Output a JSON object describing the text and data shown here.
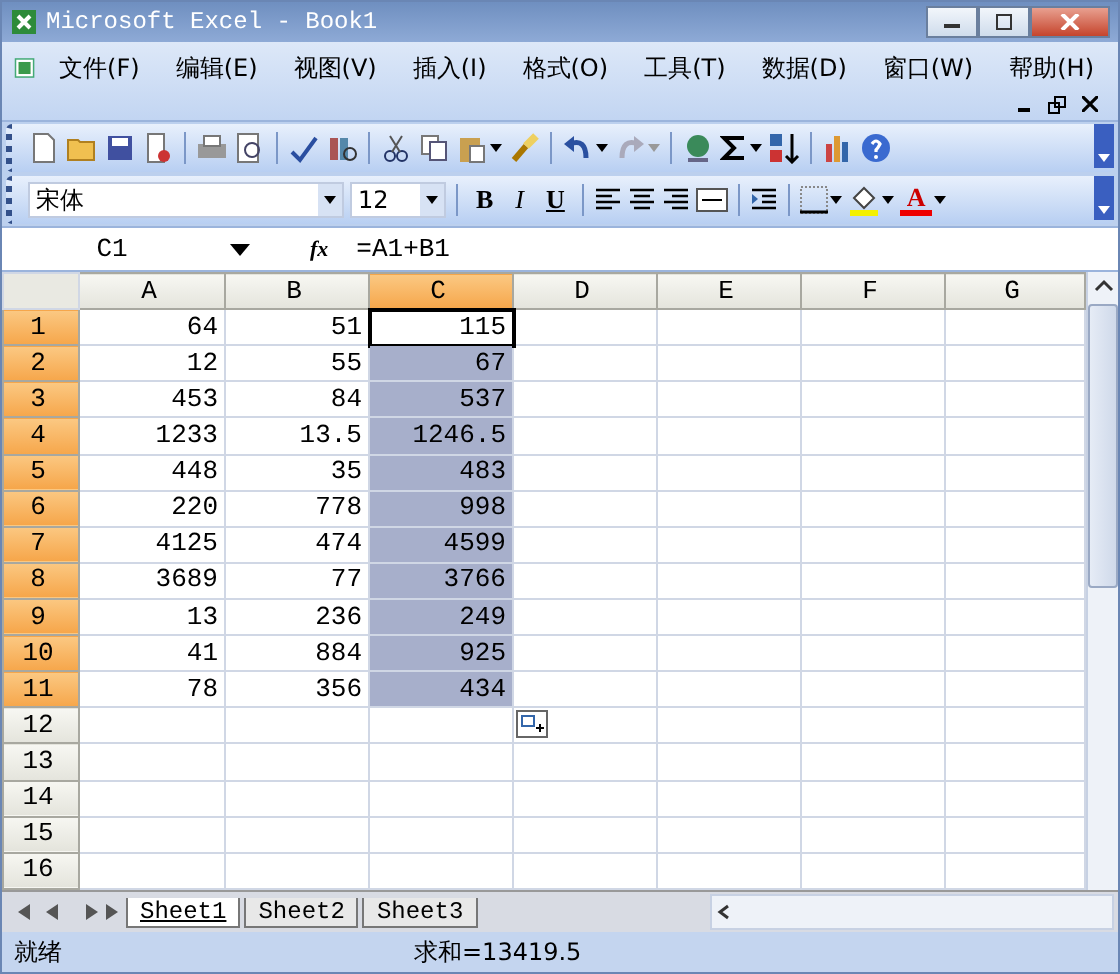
{
  "window": {
    "title": "Microsoft Excel - Book1"
  },
  "menu": [
    "文件(F)",
    "编辑(E)",
    "视图(V)",
    "插入(I)",
    "格式(O)",
    "工具(T)",
    "数据(D)",
    "窗口(W)",
    "帮助(H)"
  ],
  "format_toolbar": {
    "font": "宋体",
    "size": "12",
    "bold": "B",
    "italic": "I",
    "underline": "U",
    "font_color": "A"
  },
  "formula_bar": {
    "name_box": "C1",
    "fx": "fx",
    "formula": "=A1+B1"
  },
  "columns": [
    {
      "label": "A",
      "selected": false
    },
    {
      "label": "B",
      "selected": false
    },
    {
      "label": "C",
      "selected": true
    },
    {
      "label": "D",
      "selected": false
    },
    {
      "label": "E",
      "selected": false
    },
    {
      "label": "F",
      "selected": false
    },
    {
      "label": "G",
      "selected": false
    }
  ],
  "rows": [
    {
      "label": "1",
      "selected": true,
      "cells": [
        "64",
        "51",
        "115"
      ]
    },
    {
      "label": "2",
      "selected": true,
      "cells": [
        "12",
        "55",
        "67"
      ]
    },
    {
      "label": "3",
      "selected": true,
      "cells": [
        "453",
        "84",
        "537"
      ]
    },
    {
      "label": "4",
      "selected": true,
      "cells": [
        "1233",
        "13.5",
        "1246.5"
      ]
    },
    {
      "label": "5",
      "selected": true,
      "cells": [
        "448",
        "35",
        "483"
      ]
    },
    {
      "label": "6",
      "selected": true,
      "cells": [
        "220",
        "778",
        "998"
      ]
    },
    {
      "label": "7",
      "selected": true,
      "cells": [
        "4125",
        "474",
        "4599"
      ]
    },
    {
      "label": "8",
      "selected": true,
      "cells": [
        "3689",
        "77",
        "3766"
      ]
    },
    {
      "label": "9",
      "selected": true,
      "cells": [
        "13",
        "236",
        "249"
      ]
    },
    {
      "label": "10",
      "selected": true,
      "cells": [
        "41",
        "884",
        "925"
      ]
    },
    {
      "label": "11",
      "selected": true,
      "cells": [
        "78",
        "356",
        "434"
      ]
    },
    {
      "label": "12",
      "selected": false,
      "cells": []
    },
    {
      "label": "13",
      "selected": false,
      "cells": []
    },
    {
      "label": "14",
      "selected": false,
      "cells": []
    },
    {
      "label": "15",
      "selected": false,
      "cells": []
    },
    {
      "label": "16",
      "selected": false,
      "cells": []
    }
  ],
  "sheet_tabs": [
    {
      "label": "Sheet1",
      "selected": true
    },
    {
      "label": "Sheet2",
      "selected": false
    },
    {
      "label": "Sheet3",
      "selected": false
    }
  ],
  "status_bar": {
    "state": "就绪",
    "sum": "求和=13419.5"
  }
}
